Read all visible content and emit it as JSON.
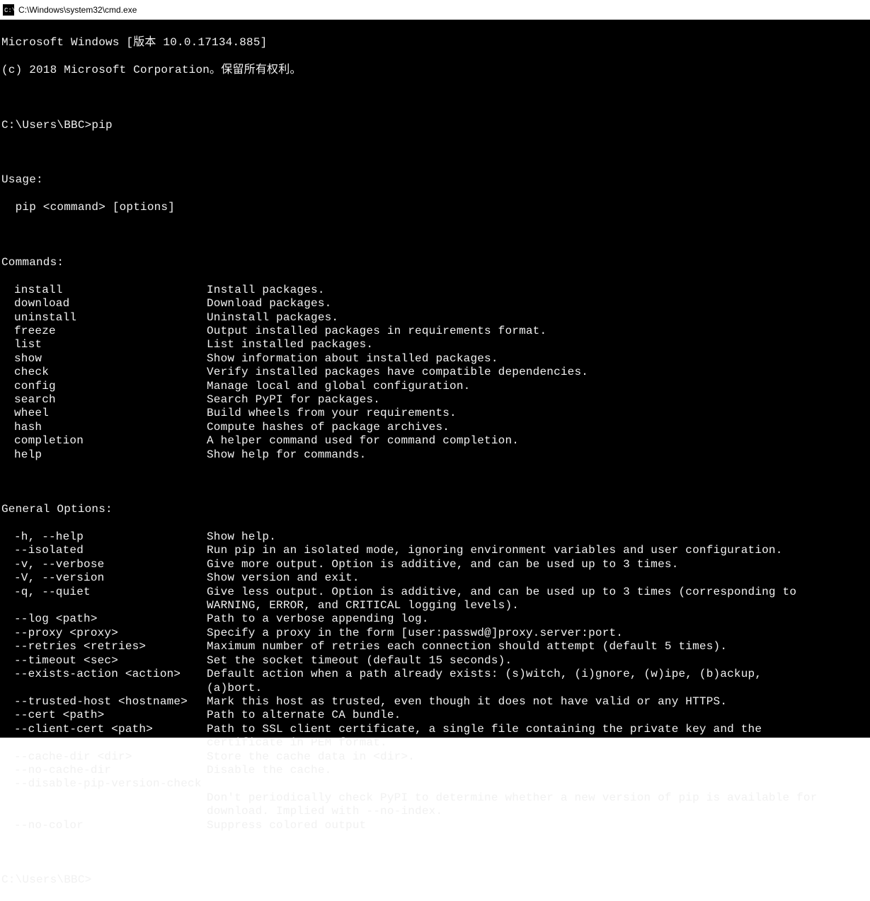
{
  "titlebar": {
    "title": "C:\\Windows\\system32\\cmd.exe"
  },
  "header": {
    "line1": "Microsoft Windows [版本 10.0.17134.885]",
    "line2": "(c) 2018 Microsoft Corporation。保留所有权利。"
  },
  "prompt1": "C:\\Users\\BBC>pip",
  "usage": {
    "header": "Usage:",
    "line": "  pip <command> [options]"
  },
  "commands_header": "Commands:",
  "commands": [
    {
      "name": "install",
      "desc": "Install packages."
    },
    {
      "name": "download",
      "desc": "Download packages."
    },
    {
      "name": "uninstall",
      "desc": "Uninstall packages."
    },
    {
      "name": "freeze",
      "desc": "Output installed packages in requirements format."
    },
    {
      "name": "list",
      "desc": "List installed packages."
    },
    {
      "name": "show",
      "desc": "Show information about installed packages."
    },
    {
      "name": "check",
      "desc": "Verify installed packages have compatible dependencies."
    },
    {
      "name": "config",
      "desc": "Manage local and global configuration."
    },
    {
      "name": "search",
      "desc": "Search PyPI for packages."
    },
    {
      "name": "wheel",
      "desc": "Build wheels from your requirements."
    },
    {
      "name": "hash",
      "desc": "Compute hashes of package archives."
    },
    {
      "name": "completion",
      "desc": "A helper command used for command completion."
    },
    {
      "name": "help",
      "desc": "Show help for commands."
    }
  ],
  "general_header": "General Options:",
  "general": [
    {
      "flag": "-h, --help",
      "desc": "Show help."
    },
    {
      "flag": "--isolated",
      "desc": "Run pip in an isolated mode, ignoring environment variables and user configuration."
    },
    {
      "flag": "-v, --verbose",
      "desc": "Give more output. Option is additive, and can be used up to 3 times."
    },
    {
      "flag": "-V, --version",
      "desc": "Show version and exit."
    },
    {
      "flag": "-q, --quiet",
      "desc": "Give less output. Option is additive, and can be used up to 3 times (corresponding to WARNING, ERROR, and CRITICAL logging levels)."
    },
    {
      "flag": "--log <path>",
      "desc": "Path to a verbose appending log."
    },
    {
      "flag": "--proxy <proxy>",
      "desc": "Specify a proxy in the form [user:passwd@]proxy.server:port."
    },
    {
      "flag": "--retries <retries>",
      "desc": "Maximum number of retries each connection should attempt (default 5 times)."
    },
    {
      "flag": "--timeout <sec>",
      "desc": "Set the socket timeout (default 15 seconds)."
    },
    {
      "flag": "--exists-action <action>",
      "desc": "Default action when a path already exists: (s)witch, (i)gnore, (w)ipe, (b)ackup, (a)bort."
    },
    {
      "flag": "--trusted-host <hostname>",
      "desc": "Mark this host as trusted, even though it does not have valid or any HTTPS."
    },
    {
      "flag": "--cert <path>",
      "desc": "Path to alternate CA bundle."
    },
    {
      "flag": "--client-cert <path>",
      "desc": "Path to SSL client certificate, a single file containing the private key and the certificate in PEM format."
    },
    {
      "flag": "--cache-dir <dir>",
      "desc": "Store the cache data in <dir>."
    },
    {
      "flag": "--no-cache-dir",
      "desc": "Disable the cache."
    },
    {
      "flag": "--disable-pip-version-check",
      "desc": "Don't periodically check PyPI to determine whether a new version of pip is available for download. Implied with --no-index."
    },
    {
      "flag": "--no-color",
      "desc": "Suppress colored output"
    }
  ],
  "prompt2": "C:\\Users\\BBC>"
}
